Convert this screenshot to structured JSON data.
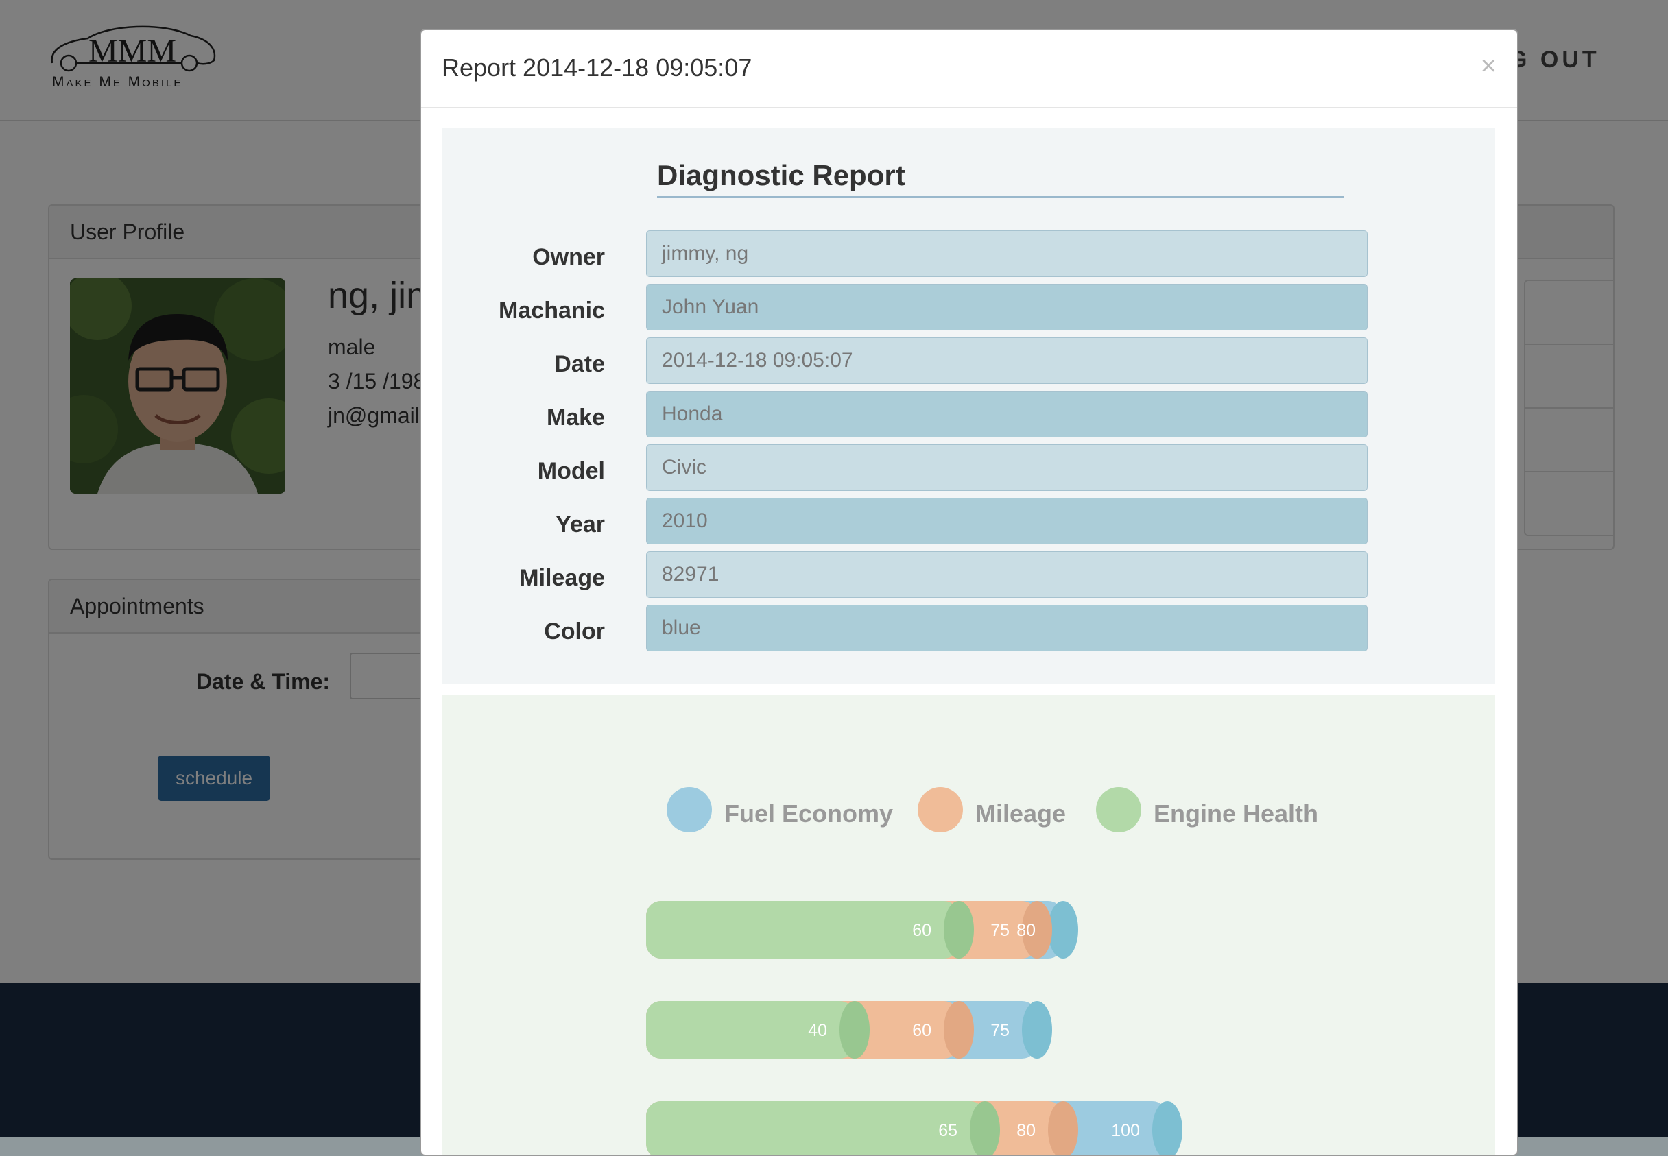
{
  "navbar": {
    "logo_letters": "MMM",
    "logo_text": "Make Me Mobile",
    "logout_visible": "G OUT"
  },
  "profile": {
    "heading": "User Profile",
    "name": "ng, jim",
    "gender": "male",
    "birthdate": "3 /15 /198",
    "email": "jn@gmail."
  },
  "appointments": {
    "heading": "Appointments",
    "datetime_label": "Date & Time:",
    "schedule_label": "schedule"
  },
  "modal": {
    "title": "Report 2014-12-18 09:05:07",
    "close": "×",
    "report_title": "Diagnostic Report",
    "fields": [
      {
        "label": "Owner",
        "value": "jimmy, ng"
      },
      {
        "label": "Machanic",
        "value": "John Yuan"
      },
      {
        "label": "Date",
        "value": "2014-12-18 09:05:07"
      },
      {
        "label": "Make",
        "value": "Honda"
      },
      {
        "label": "Model",
        "value": "Civic"
      },
      {
        "label": "Year",
        "value": "2010"
      },
      {
        "label": "Mileage",
        "value": "82971"
      },
      {
        "label": "Color",
        "value": "blue"
      }
    ]
  },
  "colors": {
    "fuel_economy": "#9ccbe0",
    "mileage": "#f0bc98",
    "engine_health": "#b2d9a8",
    "primary_button": "#2d6ca2",
    "footer": "#1a2d44"
  },
  "chart_data": {
    "type": "bar",
    "orientation": "horizontal",
    "stacking": "overlapping",
    "legend_position": "top",
    "series": [
      {
        "name": "Fuel Economy",
        "values": [
          80,
          75,
          100
        ]
      },
      {
        "name": "Mileage",
        "values": [
          75,
          60,
          80
        ]
      },
      {
        "name": "Engine Health",
        "values": [
          60,
          40,
          65
        ]
      }
    ]
  }
}
